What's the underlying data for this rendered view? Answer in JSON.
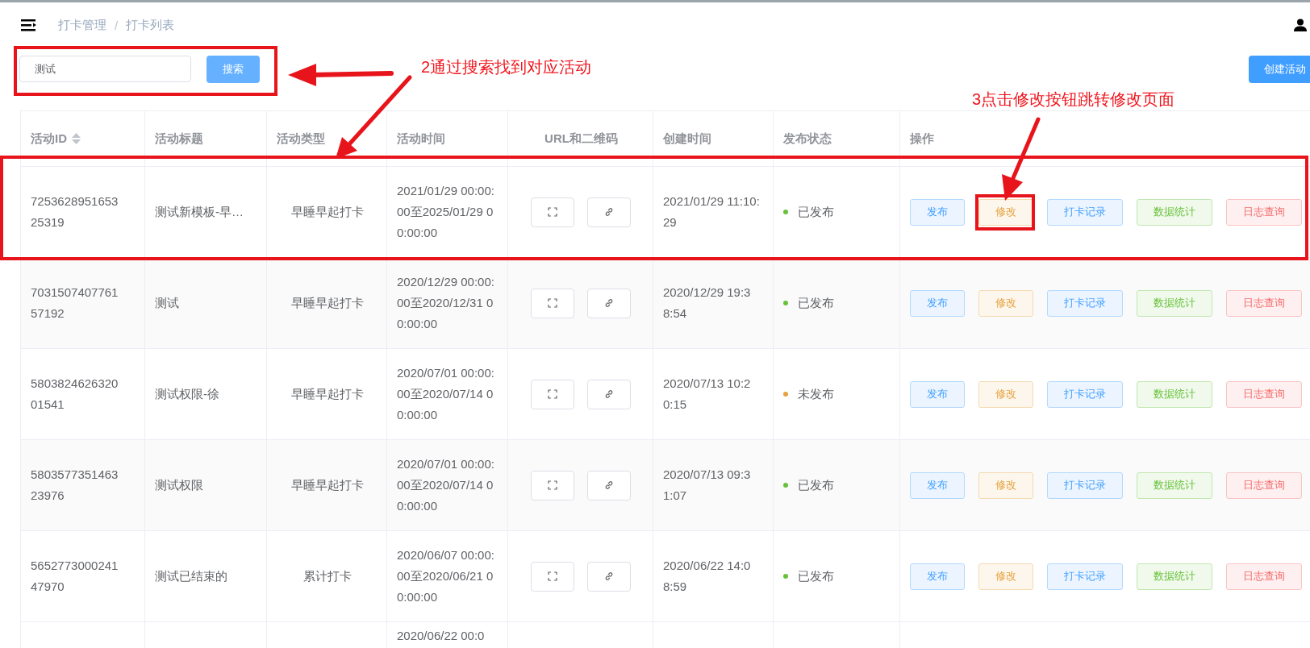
{
  "breadcrumb": [
    "打卡管理",
    "打卡列表"
  ],
  "breadcrumb_separator": "/",
  "search": {
    "value": "测试",
    "button": "搜索"
  },
  "create_button": "创建活动",
  "table": {
    "columns": [
      {
        "label": "活动ID",
        "sortable": true
      },
      {
        "label": "活动标题",
        "sortable": false
      },
      {
        "label": "活动类型",
        "sortable": false
      },
      {
        "label": "活动时间",
        "sortable": false
      },
      {
        "label": "URL和二维码",
        "sortable": false
      },
      {
        "label": "创建时间",
        "sortable": false
      },
      {
        "label": "发布状态",
        "sortable": false
      },
      {
        "label": "操作",
        "sortable": false
      }
    ],
    "rows": [
      {
        "id": "725362895165325319",
        "title": "测试新模板-早…",
        "type": "早睡早起打卡",
        "time": "2021/01/29 00:00:00至2025/01/29 00:00:00",
        "created": "2021/01/29 11:10:29",
        "status": {
          "text": "已发布",
          "color": "#67c23a"
        },
        "actions": [
          {
            "label": "发布",
            "kind": "primary"
          },
          {
            "label": "修改",
            "kind": "warning"
          },
          {
            "label": "打卡记录",
            "kind": "primary"
          },
          {
            "label": "数据统计",
            "kind": "success"
          },
          {
            "label": "日志查询",
            "kind": "danger"
          }
        ]
      },
      {
        "id": "703150740776157192",
        "title": "测试",
        "type": "早睡早起打卡",
        "time": "2020/12/29 00:00:00至2020/12/31 00:00:00",
        "created": "2020/12/29 19:38:54",
        "status": {
          "text": "已发布",
          "color": "#67c23a"
        },
        "actions": [
          {
            "label": "发布",
            "kind": "primary"
          },
          {
            "label": "修改",
            "kind": "warning"
          },
          {
            "label": "打卡记录",
            "kind": "primary"
          },
          {
            "label": "数据统计",
            "kind": "success"
          },
          {
            "label": "日志查询",
            "kind": "danger"
          }
        ]
      },
      {
        "id": "580382462632001541",
        "title": "测试权限-徐",
        "type": "早睡早起打卡",
        "time": "2020/07/01 00:00:00至2020/07/14 00:00:00",
        "created": "2020/07/13 10:20:15",
        "status": {
          "text": "未发布",
          "color": "#e6a23c"
        },
        "actions": [
          {
            "label": "发布",
            "kind": "primary"
          },
          {
            "label": "修改",
            "kind": "warning"
          },
          {
            "label": "打卡记录",
            "kind": "primary"
          },
          {
            "label": "数据统计",
            "kind": "success"
          },
          {
            "label": "日志查询",
            "kind": "danger"
          }
        ]
      },
      {
        "id": "580357735146323976",
        "title": "测试权限",
        "type": "早睡早起打卡",
        "time": "2020/07/01 00:00:00至2020/07/14 00:00:00",
        "created": "2020/07/13 09:31:07",
        "status": {
          "text": "已发布",
          "color": "#67c23a"
        },
        "actions": [
          {
            "label": "发布",
            "kind": "primary"
          },
          {
            "label": "修改",
            "kind": "warning"
          },
          {
            "label": "打卡记录",
            "kind": "primary"
          },
          {
            "label": "数据统计",
            "kind": "success"
          },
          {
            "label": "日志查询",
            "kind": "danger"
          }
        ]
      },
      {
        "id": "565277300024147970",
        "title": "测试已结束的",
        "type": "累计打卡",
        "time": "2020/06/07 00:00:00至2020/06/21 00:00:00",
        "created": "2020/06/22 14:08:59",
        "status": {
          "text": "已发布",
          "color": "#67c23a"
        },
        "actions": [
          {
            "label": "发布",
            "kind": "primary"
          },
          {
            "label": "修改",
            "kind": "warning"
          },
          {
            "label": "打卡记录",
            "kind": "primary"
          },
          {
            "label": "数据统计",
            "kind": "success"
          },
          {
            "label": "日志查询",
            "kind": "danger"
          }
        ]
      }
    ],
    "partial_row": {
      "time": "2020/06/22 00:0"
    }
  },
  "annotations": [
    {
      "text": "2通过搜索找到对应活动"
    },
    {
      "text": "3点击修改按钮跳转修改页面"
    }
  ]
}
